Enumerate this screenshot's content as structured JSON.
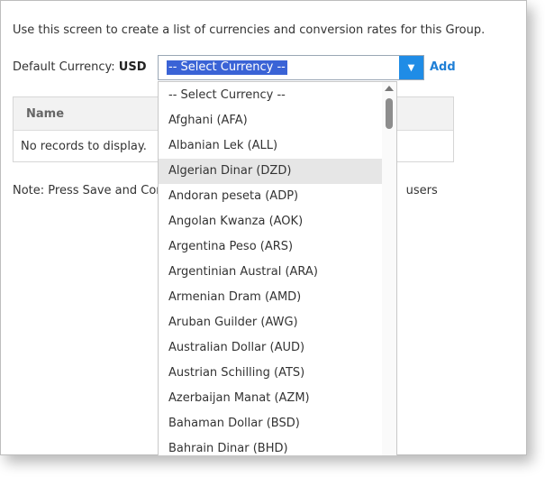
{
  "intro_text": "Use this screen to create a list of currencies and conversion rates for this Group.",
  "default_currency": {
    "label": "Default Currency:",
    "value": "USD"
  },
  "currency_select": {
    "selected": "-- Select Currency --",
    "arrow_icon": "chevron-down-icon"
  },
  "add_link": "Add",
  "grid": {
    "column_name": "Name",
    "empty_text": "No records to display."
  },
  "note_text": "Note: Press Save and Cont",
  "note_suffix": "users",
  "dropdown": {
    "highlighted_index": 3,
    "options": [
      "-- Select Currency --",
      "Afghani (AFA)",
      "Albanian Lek (ALL)",
      "Algerian Dinar (DZD)",
      "Andoran peseta (ADP)",
      "Angolan Kwanza (AOK)",
      "Argentina Peso (ARS)",
      "Argentinian Austral (ARA)",
      "Armenian Dram (AMD)",
      "Aruban Guilder (AWG)",
      "Australian Dollar (AUD)",
      "Austrian Schilling (ATS)",
      "Azerbaijan Manat (AZM)",
      "Bahaman Dollar (BSD)",
      "Bahrain Dinar (BHD)"
    ]
  },
  "colors": {
    "accent_blue": "#1f8ce6",
    "selection_blue": "#3a63d6",
    "link_blue": "#1f7fd6",
    "hover_gray": "#e6e6e6"
  }
}
